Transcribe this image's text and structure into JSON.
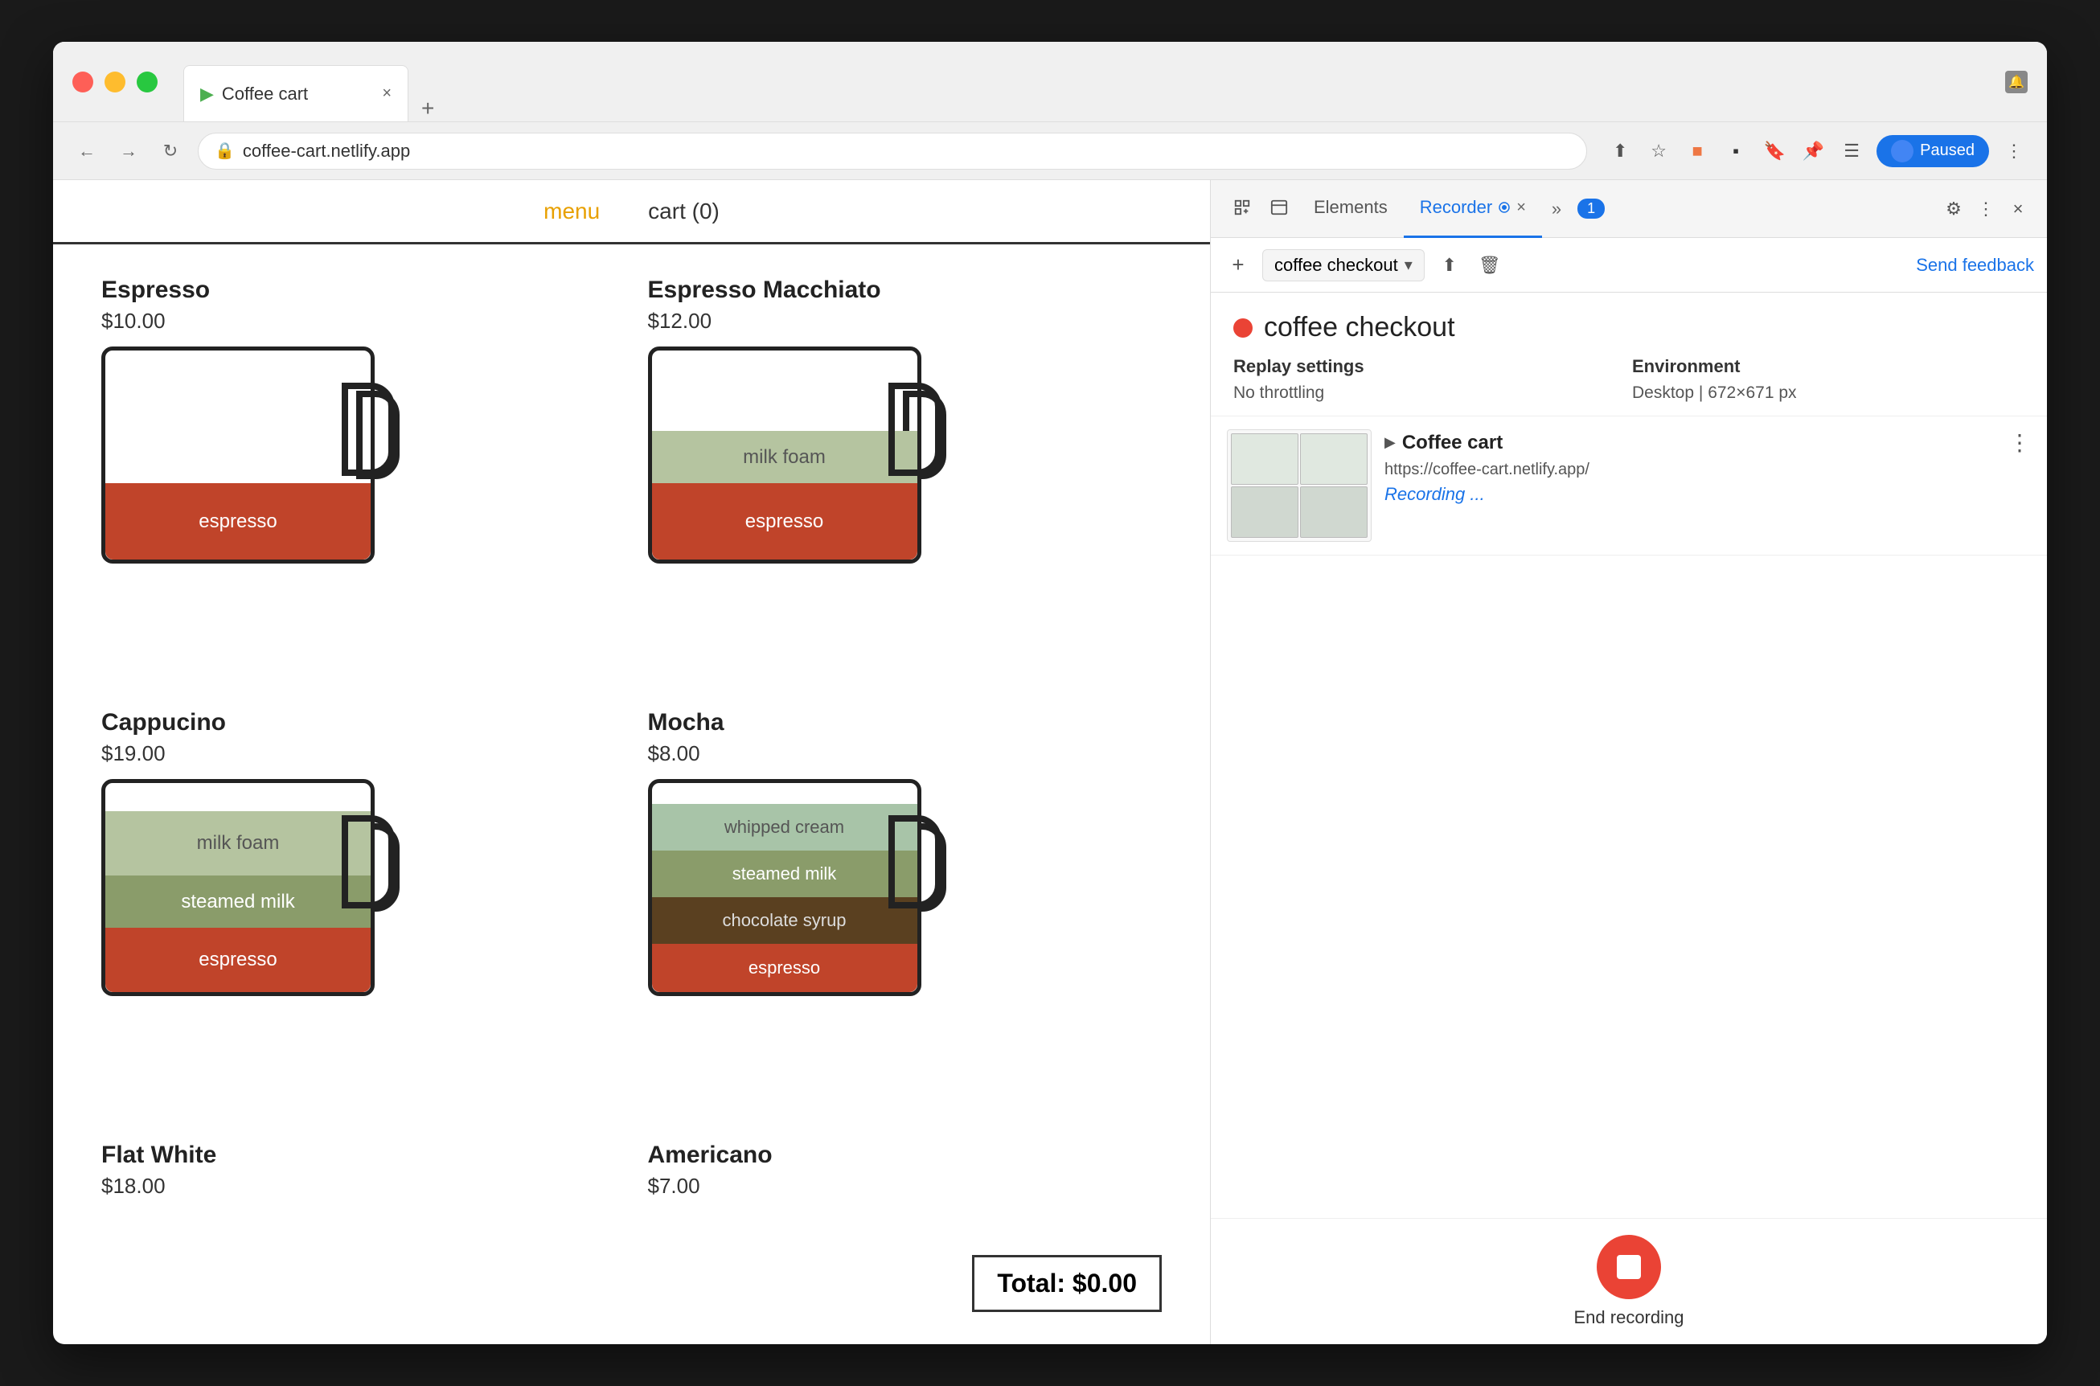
{
  "browser": {
    "tab_title": "Coffee cart",
    "tab_favicon": "▶",
    "address": "coffee-cart.netlify.app",
    "new_tab_label": "+",
    "close_tab": "×",
    "paused_label": "Paused",
    "nav": {
      "back": "←",
      "forward": "→",
      "reload": "↻"
    }
  },
  "coffee_page": {
    "nav": {
      "menu_label": "menu",
      "cart_label": "cart (0)"
    },
    "items": [
      {
        "name": "Espresso",
        "price": "$10.00",
        "layers": [
          {
            "label": "espresso",
            "class": "espresso-layer",
            "height": 90
          }
        ]
      },
      {
        "name": "Espresso Macchiato",
        "price": "$12.00",
        "layers": [
          {
            "label": "milk foam",
            "class": "milk-foam-layer",
            "height": 60
          },
          {
            "label": "espresso",
            "class": "espresso-layer",
            "height": 90
          }
        ]
      },
      {
        "name": "Cappucino",
        "price": "$19.00",
        "layers": [
          {
            "label": "milk foam",
            "class": "milk-foam-layer",
            "height": 70
          },
          {
            "label": "steamed milk",
            "class": "steamed-milk-layer",
            "height": 60
          },
          {
            "label": "espresso",
            "class": "espresso-layer",
            "height": 70
          }
        ]
      },
      {
        "name": "Mocha",
        "price": "$8.00",
        "layers": [
          {
            "label": "whipped cream",
            "class": "whipped-cream-layer",
            "height": 55
          },
          {
            "label": "steamed milk",
            "class": "steamed-milk-layer",
            "height": 55
          },
          {
            "label": "chocolate syrup",
            "class": "chocolate-syrup-layer",
            "height": 55
          },
          {
            "label": "espresso",
            "class": "espresso-layer",
            "height": 55
          }
        ]
      },
      {
        "name": "Flat White",
        "price": "$18.00",
        "layers": []
      },
      {
        "name": "Americano",
        "price": "$7.00",
        "layers": []
      }
    ],
    "total": "Total: $0.00"
  },
  "devtools": {
    "tabs": [
      {
        "label": "Elements",
        "active": false
      },
      {
        "label": "Recorder",
        "active": true
      },
      {
        "label": "×",
        "active": false
      }
    ],
    "more_tabs_label": "»",
    "badge": "1",
    "settings_icon": "⚙",
    "more_icon": "⋮",
    "close_icon": "×",
    "plus_btn": "+",
    "recording_name": "coffee checkout",
    "dropdown_arrow": "▾",
    "upload_icon": "⬆",
    "delete_icon": "🗑",
    "send_feedback": "Send feedback",
    "recording_dot_color": "#ea4335",
    "recording_title": "coffee checkout",
    "replay_settings_label": "Replay settings",
    "no_throttling_label": "No throttling",
    "environment_label": "Environment",
    "desktop_label": "Desktop",
    "resolution_label": "672×671 px",
    "site_name": "Coffee cart",
    "site_url": "https://coffee-cart.netlify.app/",
    "recording_status": "Recording ...",
    "end_recording_label": "End recording"
  }
}
